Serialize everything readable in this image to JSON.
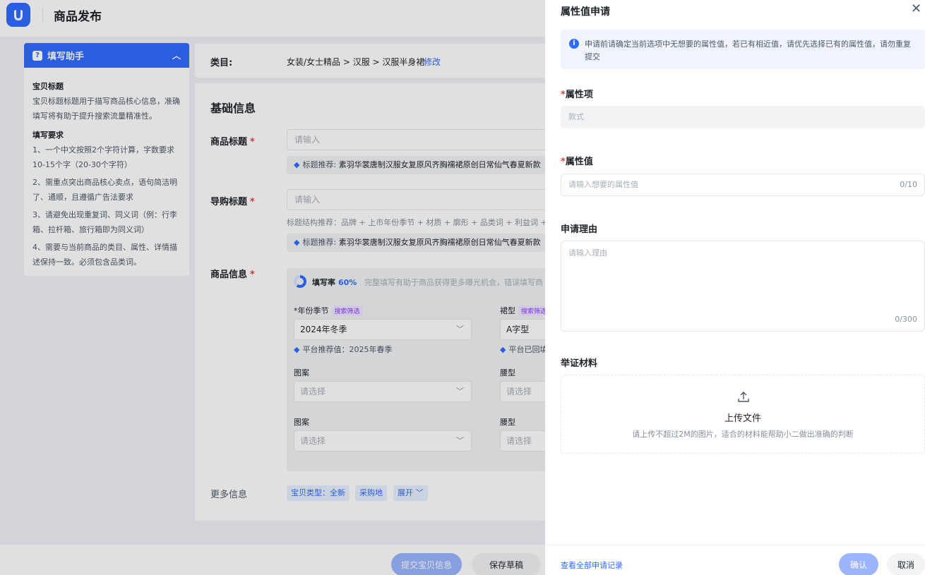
{
  "header": {
    "title": "商品发布"
  },
  "helper": {
    "title": "填写助手",
    "sections": [
      {
        "heading": "宝贝标题",
        "lines": [
          "宝贝标题标题用于描写商品核心信息，准确填写将有助于提升搜索流量精准性。"
        ]
      },
      {
        "heading": "填写要求",
        "lines": [
          "1、一个中文按照2个字符计算，字数要求10-15个字（20-30个字符）",
          "2、需重点突出商品核心卖点，语句简洁明了、通顺，且遵循广告法要求",
          "3、请避免出现重复词、同义词（例：行李箱、拉杆箱、旅行箱即为同义词）",
          "4、需要与当前商品的类目、属性、详情描述保持一致。必须包含品类词。"
        ]
      }
    ]
  },
  "category": {
    "label": "类目:",
    "path": "女装/女士精品 > 汉服 > 汉服半身裙",
    "edit": "修改"
  },
  "form": {
    "section_title": "基础信息",
    "title_label": "商品标题",
    "title_placeholder": "请输入",
    "title_tip_prefix": "标题推荐:",
    "title_tip": "素羽华裳唐制汉服女复原风齐胸襦裙原创日常仙气春夏新款",
    "guide_label": "导购标题",
    "guide_placeholder": "请输入",
    "structure": "标题结构推荐：品牌 + 上市年份季节 + 材质 + 廓形 + 品类词 + 利益词 +",
    "guide_tip_prefix": "标题推荐:",
    "guide_tip": "素羽华裳唐制汉服女复原风齐胸襦裙原创日常仙气春夏新款",
    "info_label": "商品信息",
    "fill_rate_label": "填写率",
    "fill_rate": "60%",
    "fill_rate_value": 0.6,
    "fill_rate_desc": "完整填写有助于商品获得更多曝光机会，错误填写商",
    "season_label": "*年份季节",
    "search_badge": "搜索筛选",
    "season_value": "2024年冬季",
    "season_rec": "平台推荐值：2025年春季",
    "skirt_label": "裙型",
    "skirt_value": "A字型",
    "skirt_rec": "平台已回填",
    "pattern_label": "图案",
    "pattern_placeholder": "请选择",
    "waist_label": "腰型",
    "waist_placeholder": "请选择",
    "pattern2_label": "图案",
    "pattern2_placeholder": "请选择",
    "waist2_label": "腰型",
    "waist2_placeholder": "请选择",
    "more_label": "更多信息",
    "tag_type": "宝贝类型：全新",
    "tag_origin": "采购地",
    "tag_expand": "展开"
  },
  "bottom": {
    "submit": "提交宝贝信息",
    "draft": "保存草稿"
  },
  "drawer": {
    "title": "属性值申请",
    "notice": "申请前请确定当前选项中无想要的属性值，若已有相近值，请优先选择已有的属性值，请勿重复提交",
    "attr_item_label": "属性项",
    "attr_item_value": "款式",
    "attr_value_label": "属性值",
    "attr_value_placeholder": "请输入想要的属性值",
    "attr_value_count": "0/10",
    "reason_label": "申请理由",
    "reason_placeholder": "请输入理由",
    "reason_count": "0/300",
    "evidence_label": "举证材料",
    "upload_title": "上传文件",
    "upload_hint": "请上传不超过2M的图片，适合的材料能帮助小二做出准确的判断",
    "history_link": "查看全部申请记录",
    "confirm": "确认",
    "cancel": "取消"
  }
}
